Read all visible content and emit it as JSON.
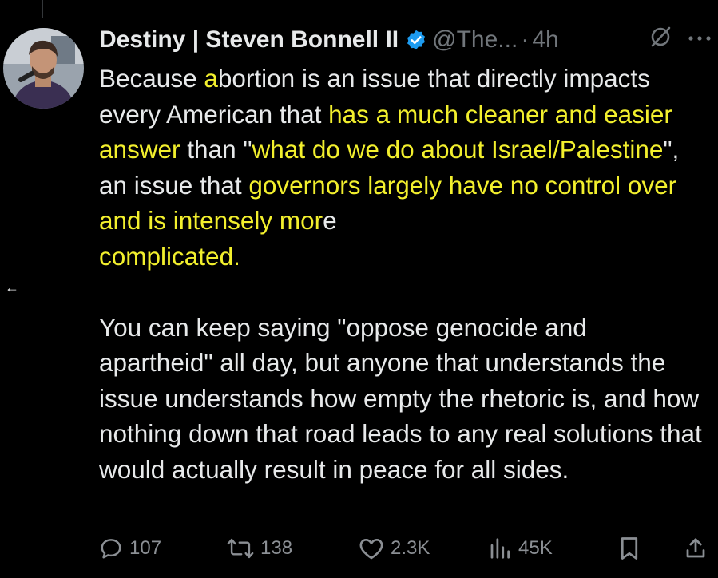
{
  "tweet": {
    "author_name": "Destiny | Steven Bonnell II",
    "handle": "@The...",
    "separator": "·",
    "time": "4h",
    "body": {
      "p1_s1": "Because ",
      "p1_s2": "a",
      "p1_s3": "bortion is an issue that directly impacts every American that ",
      "p1_s4": "has a much cleaner and easier answer",
      "p1_s5": " than \"",
      "p1_s6": "what do we do about Israel/Palestine",
      "p1_s7": "\", an issue that ",
      "p1_s8": "governors largely have no control over and is intensely mor",
      "p1_s9": "e",
      "p1_s10": "complicated.",
      "p2": "You can keep saying \"oppose genocide and apartheid\" all day, but anyone that understands the issue understands how empty the rhetoric is, and how nothing down that road leads to any real solutions that would actually result in peace for all sides."
    },
    "metrics": {
      "replies": "107",
      "reposts": "138",
      "likes": "2.3K",
      "views": "45K"
    },
    "icons": {
      "verified": "verified-badge-icon",
      "grok": "grok-icon",
      "more": "more-icon",
      "reply": "reply-icon",
      "repost": "repost-icon",
      "like": "like-icon",
      "views": "views-icon",
      "bookmark": "bookmark-icon",
      "share": "share-icon",
      "back": "back-arrow-icon"
    },
    "colors": {
      "background": "#000000",
      "text": "#e7e9ea",
      "muted": "#71767b",
      "highlight": "#f2ef2d",
      "verified": "#1d9bf0"
    }
  },
  "nav": {
    "back_glyph": "←"
  }
}
